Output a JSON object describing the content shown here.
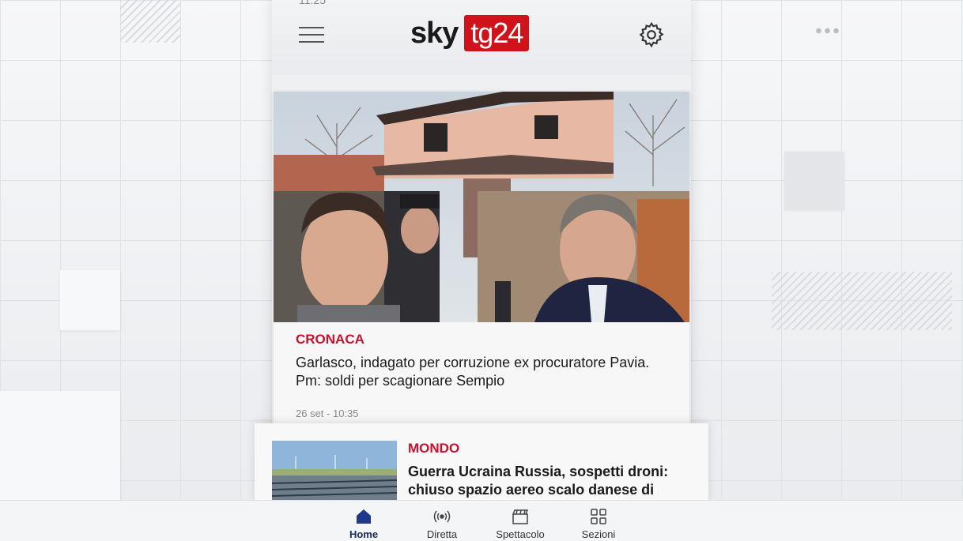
{
  "status_bar": {
    "time": "11:25"
  },
  "header": {
    "logo_left": "sky",
    "logo_right": "tg24",
    "menu_icon": "hamburger-icon",
    "settings_icon": "gear-icon"
  },
  "colors": {
    "brand_red": "#d0121b",
    "category_red": "#c8102e",
    "nav_active": "#1f3a8a"
  },
  "articles": [
    {
      "category": "CRONACA",
      "headline": "Garlasco, indagato per corruzione ex procuratore Pavia. Pm: soldi per scagionare Sempio",
      "timestamp": "26 set - 10:35"
    },
    {
      "category": "MONDO",
      "headline": "Guerra Ucraina Russia, sospetti droni: chiuso spazio aereo scalo danese di"
    }
  ],
  "bottom_nav": [
    {
      "label": "Home",
      "icon": "home-icon",
      "active": true
    },
    {
      "label": "Diretta",
      "icon": "live-broadcast-icon",
      "active": false
    },
    {
      "label": "Spettacolo",
      "icon": "clapperboard-icon",
      "active": false
    },
    {
      "label": "Sezioni",
      "icon": "grid-icon",
      "active": false
    }
  ]
}
